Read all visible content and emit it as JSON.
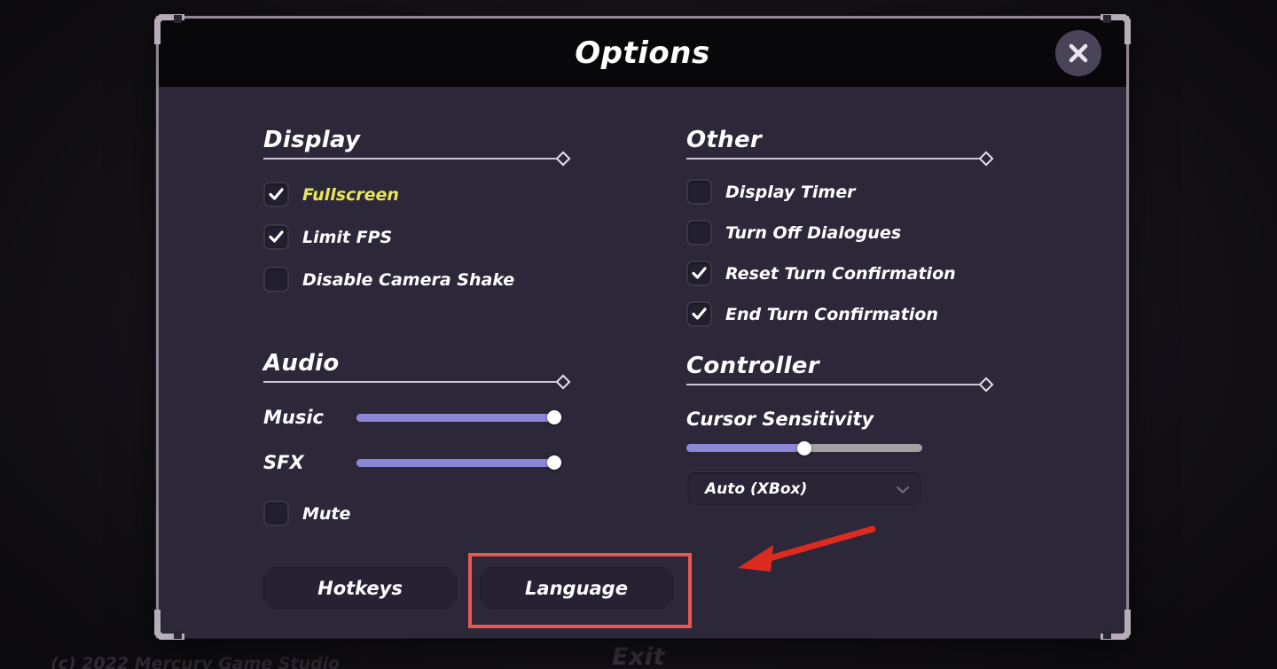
{
  "window": {
    "title": "Options",
    "close_icon": "close-x-icon"
  },
  "background": {
    "menu_exit_label": "Exit",
    "copyright": "(c) 2022 Mercury Game Studio"
  },
  "sections": {
    "display": {
      "heading": "Display",
      "options": [
        {
          "label": "Fullscreen",
          "checked": true,
          "highlighted": true
        },
        {
          "label": "Limit FPS",
          "checked": true,
          "highlighted": false
        },
        {
          "label": "Disable Camera Shake",
          "checked": false,
          "highlighted": false
        }
      ]
    },
    "other": {
      "heading": "Other",
      "options": [
        {
          "label": "Display Timer",
          "checked": false,
          "highlighted": false
        },
        {
          "label": "Turn Off Dialogues",
          "checked": false,
          "highlighted": false
        },
        {
          "label": "Reset Turn Confirmation",
          "checked": true,
          "highlighted": false
        },
        {
          "label": "End Turn Confirmation",
          "checked": true,
          "highlighted": false
        }
      ]
    },
    "audio": {
      "heading": "Audio",
      "sliders": [
        {
          "label": "Music",
          "value": 100
        },
        {
          "label": "SFX",
          "value": 100
        }
      ],
      "mute": {
        "label": "Mute",
        "checked": false
      }
    },
    "controller": {
      "heading": "Controller",
      "sensitivity": {
        "label": "Cursor Sensitivity",
        "value": 50
      },
      "device": {
        "selected": "Auto (XBox)",
        "chevron_icon": "chevron-down-icon"
      }
    }
  },
  "footer": {
    "hotkeys_label": "Hotkeys",
    "language_label": "Language"
  },
  "annotation": {
    "arrow_color": "#dd2b20",
    "highlight_color": "#e8584f"
  },
  "colors": {
    "panel_bg": "#2c2839",
    "titlebar_bg": "#08070a",
    "frame_border": "#8e8494",
    "slider_fill": "#8d87d8",
    "slider_track": "#a5a1a3",
    "highlight_text": "#e8e45c"
  }
}
